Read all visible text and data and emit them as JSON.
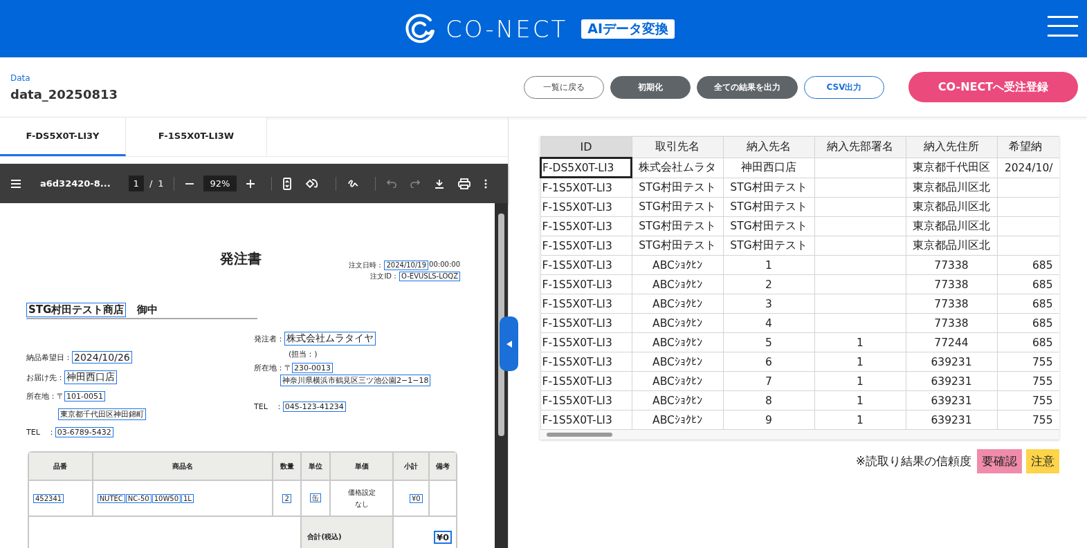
{
  "header": {
    "logo_text": "CO-NECT",
    "badge": "AIデータ変換"
  },
  "page": {
    "label": "Data",
    "title": "data_20250813"
  },
  "actions": [
    {
      "label": "一覧に戻る",
      "kind": "outline"
    },
    {
      "label": "初期化",
      "kind": "dark"
    },
    {
      "label": "全ての結果を出力",
      "kind": "dark"
    },
    {
      "label": "CSV出力",
      "kind": "outline-blue"
    },
    {
      "label": "CO-NECTへ受注登録",
      "kind": "primary"
    }
  ],
  "file_tabs": [
    {
      "label": "F-DS5X0T-LI3Y",
      "selected": true
    },
    {
      "label": "F-1S5X0T-LI3W",
      "selected": false
    }
  ],
  "pdf_viewer": {
    "filename": "a6d32420-8...",
    "page": "1",
    "separator": "/",
    "page_count": "1",
    "zoom": "92%",
    "undo": {
      "disabled": true
    },
    "redo": {
      "disabled": true
    }
  },
  "document": {
    "title": "発注書",
    "order_meta": [
      {
        "label": "注文日時：",
        "value": "2024/10/19",
        "suffix": "00:00:00"
      },
      {
        "label": "注文ID：",
        "value": "O-EVUSLS-LOQZ"
      }
    ],
    "addressee": {
      "name": "STG村田テスト商店",
      "honorific": "御中"
    },
    "delivery": [
      {
        "label": "納品希望日：",
        "value": "2024/10/26",
        "kind": "large"
      },
      {
        "label": "お届け先：",
        "value": "神田西口店",
        "kind": "large"
      },
      {
        "label": "所在地：〒",
        "value": "101-0051",
        "kind": "small"
      },
      {
        "value": "東京都千代田区神田錦町",
        "kind": "indent"
      },
      {
        "label": "TEL　：",
        "value": "03-6789-5432",
        "kind": "small"
      }
    ],
    "orderer": [
      {
        "label": "発注者：",
        "value": "株式会社ムラタイヤ",
        "kind": "large"
      },
      {
        "note": "(担当：)",
        "kind": "note"
      },
      {
        "label": "所在地：〒",
        "value": "230-0013",
        "kind": "small"
      },
      {
        "value": "神奈川県横浜市鶴見区三ツ池公園2−1−18",
        "kind": "indent"
      },
      {
        "label": "TEL　：",
        "value": "045-123-41234",
        "kind": "small"
      }
    ],
    "items": {
      "columns": [
        "品番",
        "商品名",
        "数量",
        "単位",
        "単価",
        "小計",
        "備考"
      ],
      "rows": [
        {
          "cells": [
            {
              "kind": "boxed",
              "tokens": [
                "452341"
              ]
            },
            {
              "kind": "boxed",
              "tokens": [
                "NUTEC",
                "NC-50",
                "10W50",
                "1L"
              ]
            },
            {
              "kind": "boxed",
              "tokens": [
                "2"
              ]
            },
            {
              "kind": "boxed",
              "tokens": [
                "缶"
              ]
            },
            {
              "kind": "plain",
              "text": "価格設定なし"
            },
            {
              "kind": "boxed",
              "tokens": [
                "¥0"
              ]
            }
          ]
        }
      ],
      "total": {
        "label": "合計(税込)",
        "value": "¥0"
      }
    }
  },
  "results_table": {
    "columns": [
      "ID",
      "取引先名",
      "納入先名",
      "納入先部署名",
      "納入先住所",
      "希望納"
    ],
    "rows": [
      {
        "selected": true,
        "cells": [
          "F-DS5X0T-LI3",
          "株式会社ムラタ",
          "神田西口店",
          "",
          "東京都千代田区",
          "2024/10/"
        ]
      },
      {
        "selected": false,
        "cells": [
          "F-1S5X0T-LI3",
          "STG村田テスト",
          "STG村田テスト",
          "",
          "東京都品川区北",
          ""
        ]
      },
      {
        "selected": false,
        "cells": [
          "F-1S5X0T-LI3",
          "STG村田テスト",
          "STG村田テスト",
          "",
          "東京都品川区北",
          ""
        ]
      },
      {
        "selected": false,
        "cells": [
          "F-1S5X0T-LI3",
          "STG村田テスト",
          "STG村田テスト",
          "",
          "東京都品川区北",
          ""
        ]
      },
      {
        "selected": false,
        "cells": [
          "F-1S5X0T-LI3",
          "STG村田テスト",
          "STG村田テスト",
          "",
          "東京都品川区北",
          ""
        ]
      },
      {
        "selected": false,
        "cells": [
          "F-1S5X0T-LI3",
          "ABCｼｮｸﾋﾝ",
          "1",
          "",
          "77338",
          "685"
        ]
      },
      {
        "selected": false,
        "cells": [
          "F-1S5X0T-LI3",
          "ABCｼｮｸﾋﾝ",
          "2",
          "",
          "77338",
          "685"
        ]
      },
      {
        "selected": false,
        "cells": [
          "F-1S5X0T-LI3",
          "ABCｼｮｸﾋﾝ",
          "3",
          "",
          "77338",
          "685"
        ]
      },
      {
        "selected": false,
        "cells": [
          "F-1S5X0T-LI3",
          "ABCｼｮｸﾋﾝ",
          "4",
          "",
          "77338",
          "685"
        ]
      },
      {
        "selected": false,
        "cells": [
          "F-1S5X0T-LI3",
          "ABCｼｮｸﾋﾝ",
          "5",
          "1",
          "77244",
          "685"
        ]
      },
      {
        "selected": false,
        "cells": [
          "F-1S5X0T-LI3",
          "ABCｼｮｸﾋﾝ",
          "6",
          "1",
          "639231",
          "755"
        ]
      },
      {
        "selected": false,
        "cells": [
          "F-1S5X0T-LI3",
          "ABCｼｮｸﾋﾝ",
          "7",
          "1",
          "639231",
          "755"
        ]
      },
      {
        "selected": false,
        "cells": [
          "F-1S5X0T-LI3",
          "ABCｼｮｸﾋﾝ",
          "8",
          "1",
          "639231",
          "755"
        ]
      },
      {
        "selected": false,
        "cells": [
          "F-1S5X0T-LI3",
          "ABCｼｮｸﾋﾝ",
          "9",
          "1",
          "639231",
          "755"
        ]
      }
    ]
  },
  "legend": {
    "note": "※読取り結果の信頼度",
    "levels": [
      {
        "label": "要確認",
        "color": "#f08cab"
      },
      {
        "label": "注意",
        "color": "#fdd44a"
      }
    ]
  }
}
